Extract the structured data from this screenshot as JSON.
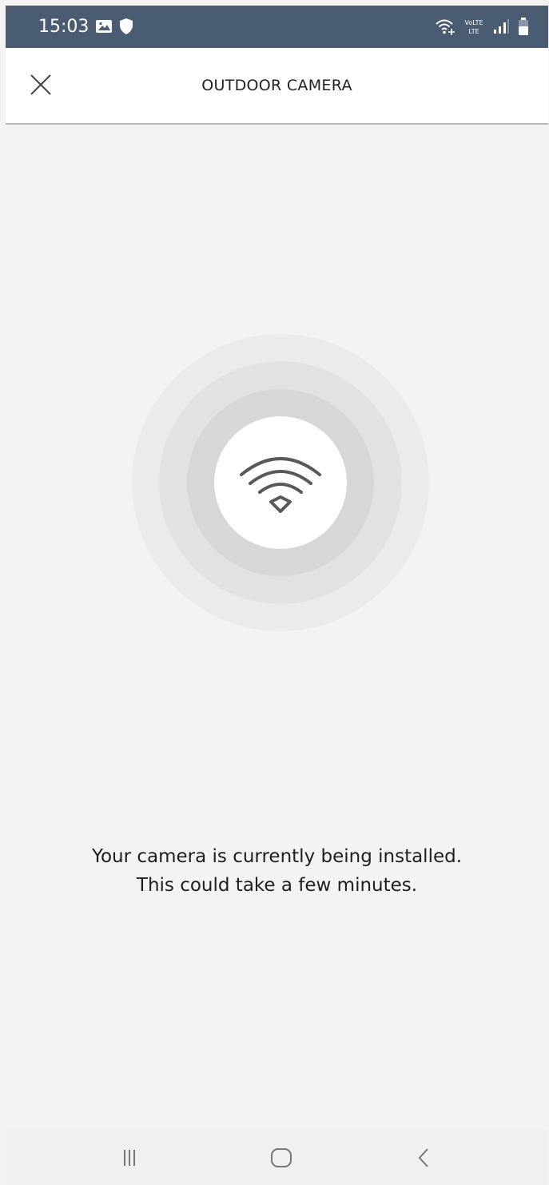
{
  "status_bar": {
    "time": "15:03",
    "background_color": "#4a5c72",
    "left_icons": [
      "gallery-icon",
      "shield-icon"
    ],
    "right_icons": [
      "wifi-calling-icon",
      "volte-icon",
      "signal-icon",
      "battery-icon"
    ],
    "volte_label": "VoLTE"
  },
  "app_bar": {
    "title": "OUTDOOR CAMERA",
    "close_icon": "close-icon"
  },
  "main": {
    "status_icon": "wifi-icon",
    "message_line_1": "Your camera is currently being installed.",
    "message_line_2": "This could take a few minutes."
  },
  "nav_bar": {
    "buttons": [
      "recents-icon",
      "home-icon",
      "back-icon"
    ]
  }
}
